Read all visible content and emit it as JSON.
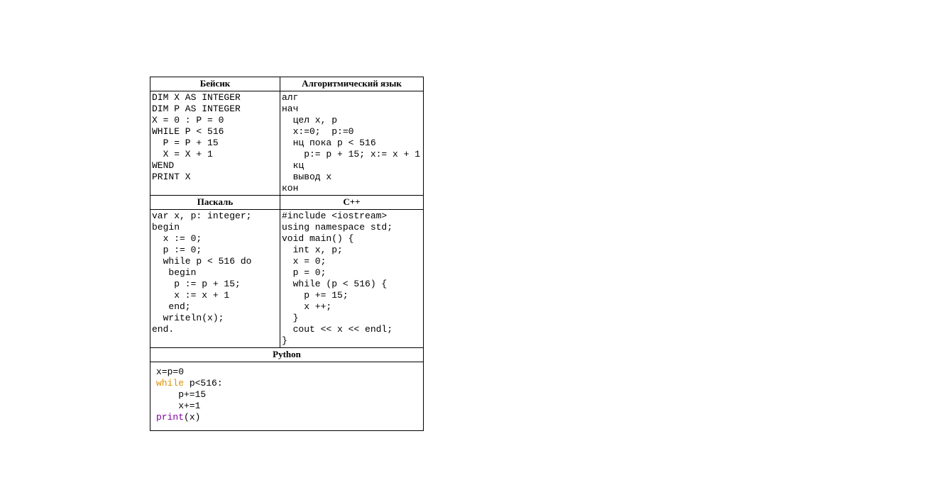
{
  "headers": {
    "basic": "Бейсик",
    "algo": "Алгоритмический язык",
    "pascal": "Паскаль",
    "cpp": "С++",
    "python": "Python"
  },
  "code": {
    "basic": "DIM X AS INTEGER\nDIM P AS INTEGER\nX = 0 : P = 0\nWHILE P < 516\n  P = P + 15\n  X = X + 1\nWEND\nPRINT X\n ",
    "algo": "алг\nнач\n  цел x, p\n  x:=0;  p:=0\n  нц пока p < 516\n    p:= p + 15; x:= x + 1\n  кц\n  вывод x\nкон",
    "pascal": "var x, p: integer;\nbegin\n  x := 0;\n  p := 0;\n  while p < 516 do\n   begin\n    p := p + 15;\n    x := x + 1\n   end;\n  writeln(x);\nend.",
    "cpp": "#include <iostream>\nusing namespace std;\nvoid main() {\n  int x, p;\n  x = 0;\n  p = 0;\n  while (p < 516) {\n    p += 15;\n    x ++;\n  }\n  cout << x << endl;\n}"
  },
  "python": {
    "l1": "x=p=0",
    "l2a": "while",
    "l2b": " p<516:",
    "l3": "    p+=15",
    "l4": "    x+=1",
    "l5a": "print",
    "l5b": "(x)"
  }
}
